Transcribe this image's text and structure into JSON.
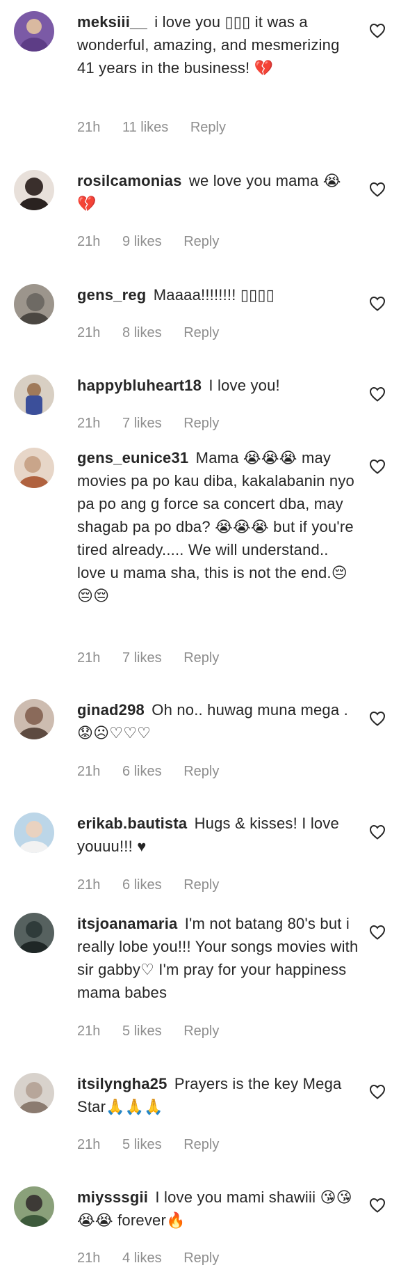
{
  "comments": [
    {
      "username": "meksiii__",
      "text": "i love you ▯▯▯ it was a wonderful, amazing, and mesmerizing 41 years in the business! 💔",
      "time": "21h",
      "likes": "11 likes",
      "reply": "Reply",
      "avatar_color": "#7b5aa6"
    },
    {
      "username": "rosilcamonias",
      "text": "we love you mama 😭💔",
      "time": "21h",
      "likes": "9 likes",
      "reply": "Reply",
      "avatar_color": "#3a2f2c"
    },
    {
      "username": "gens_reg",
      "text": "Maaaa!!!!!!!! ▯▯▯▯",
      "time": "21h",
      "likes": "8 likes",
      "reply": "Reply",
      "avatar_color": "#6e6a64"
    },
    {
      "username": "happybluheart18",
      "text": "I love you!",
      "time": "21h",
      "likes": "7 likes",
      "reply": "Reply",
      "avatar_color": "#3b4f9a"
    },
    {
      "username": "gens_eunice31",
      "text": "Mama 😭😭😭 may movies pa po kau diba, kakalabanin nyo pa po ang g force sa concert dba, may shagab pa po dba? 😭😭😭 but if you're tired already..... We will understand.. love u mama sha, this is not the end.😔😔😔",
      "time": "21h",
      "likes": "7 likes",
      "reply": "Reply",
      "avatar_color": "#c9a58a"
    },
    {
      "username": "ginad298",
      "text": "Oh no.. huwag muna mega .😟☹♡♡♡",
      "time": "21h",
      "likes": "6 likes",
      "reply": "Reply",
      "avatar_color": "#8a6a5a"
    },
    {
      "username": "erikab.bautista",
      "text": "Hugs & kisses! I love youuu!!! ♥",
      "time": "21h",
      "likes": "6 likes",
      "reply": "Reply",
      "avatar_color": "#bcd6e8"
    },
    {
      "username": "itsjoanamaria",
      "text": "I'm not batang 80's but i really lobe you!!! Your songs movies with sir gabby♡ I'm pray for your happiness mama babes",
      "time": "21h",
      "likes": "5 likes",
      "reply": "Reply",
      "avatar_color": "#2f3b3a"
    },
    {
      "username": "itsilyngha25",
      "text": "Prayers is the key Mega Star🙏🙏🙏",
      "time": "21h",
      "likes": "5 likes",
      "reply": "Reply",
      "avatar_color": "#b7a69a"
    },
    {
      "username": "miysssgii",
      "text": "I love you mami shawiii 😘😘😭😭 forever🔥",
      "time": "21h",
      "likes": "4 likes",
      "reply": "Reply",
      "avatar_color": "#3d5a3b"
    }
  ]
}
